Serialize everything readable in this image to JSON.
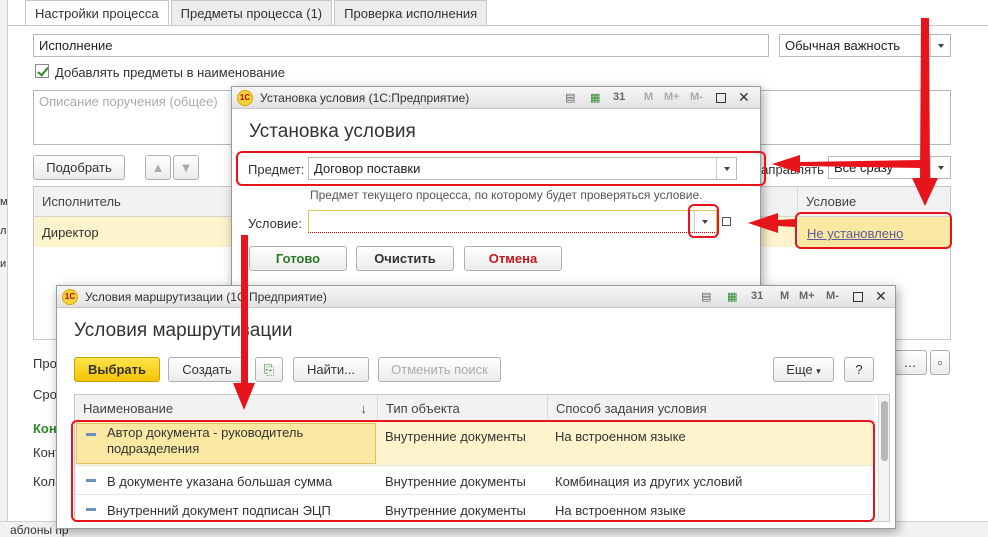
{
  "background": {
    "tabs": [
      {
        "label": "Настройки процесса",
        "active": true
      },
      {
        "label": "Предметы процесса (1)",
        "active": false
      },
      {
        "label": "Проверка исполнения",
        "active": false
      }
    ],
    "name_value": "Исполнение",
    "importance_value": "Обычная важность",
    "add_items_checkbox_label": "Добавлять предметы в наименование",
    "description_placeholder": "Описание поручения (общее)",
    "pick_button": "Подобрать",
    "order_partial": "направлять",
    "order_value": "Все сразу",
    "grid": {
      "col_executor": "Исполнитель",
      "col_condition": "Условие",
      "row_executor": "Директор",
      "row_condition": "Не установлено"
    },
    "left_cut_labels": [
      "Про",
      "Срок",
      "Кон",
      "Конт",
      "Кол"
    ],
    "bottom_cut_label": "аблоны пр",
    "left_strip_marks": [
      "м",
      "л",
      "и"
    ]
  },
  "condition_dialog": {
    "window_title": "Установка условия  (1С:Предприятие)",
    "heading": "Установка условия",
    "subject_label": "Предмет:",
    "subject_value": "Договор поставки",
    "subject_hint": "Предмет текущего процесса, по которому будет проверяться условие.",
    "condition_label": "Условие:",
    "condition_value": "",
    "btn_done": "Готово",
    "btn_clear": "Очистить",
    "btn_cancel": "Отмена",
    "tb_m": "M",
    "tb_mplus": "M+",
    "tb_mminus": "M-",
    "tb_cal": "31"
  },
  "routing_dialog": {
    "window_title": "Условия маршрутизации  (1С:Предприятие)",
    "heading": "Условия маршрутизации",
    "btn_select": "Выбрать",
    "btn_create": "Создать",
    "btn_find": "Найти...",
    "btn_cancel_search": "Отменить поиск",
    "btn_more": "Еще",
    "btn_help": "?",
    "tb_m": "M",
    "tb_mplus": "M+",
    "tb_mminus": "M-",
    "tb_cal": "31",
    "columns": [
      "Наименование",
      "Тип объекта",
      "Способ задания условия"
    ],
    "sort_indicator": "↓",
    "rows": [
      {
        "name": "Автор документа - руководитель",
        "name2": "подразделения",
        "type": "Внутренние документы",
        "method": "На встроенном языке"
      },
      {
        "name": "В документе указана большая сумма",
        "name2": "",
        "type": "Внутренние документы",
        "method": "Комбинация из других условий"
      },
      {
        "name": "Внутренний документ подписан ЭЦП",
        "name2": "",
        "type": "Внутренние документы",
        "method": "На встроенном языке"
      }
    ]
  },
  "colors": {
    "accent_red": "#e8141b",
    "selected_row": "#fbe9a3",
    "yellow_button": "#f3c400",
    "done_text": "#2a7a2a",
    "cancel_text": "#c0181b"
  }
}
